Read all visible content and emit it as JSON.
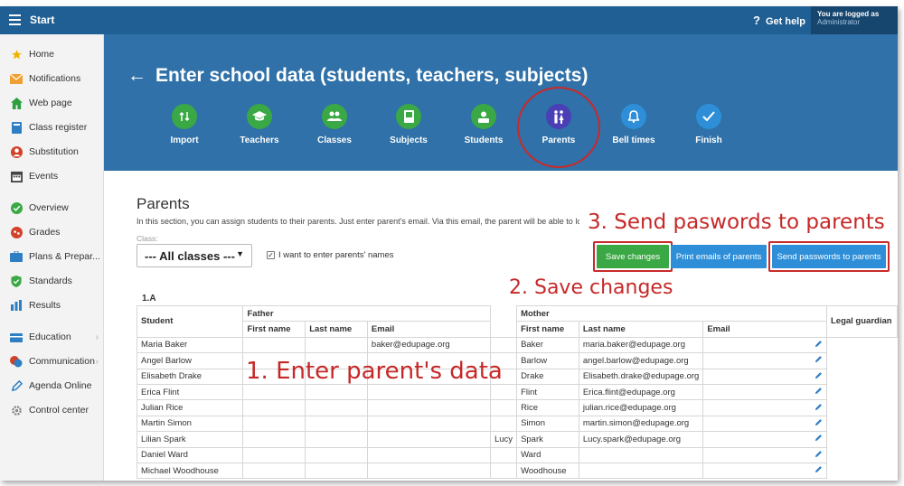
{
  "topbar": {
    "start_label": "Start",
    "help_label": "Get help",
    "help_icon": "?",
    "login_line1": "You are logged as",
    "login_line2": "Administrator"
  },
  "sidebar": {
    "items": [
      {
        "label": "Home",
        "icon": "star-icon",
        "color": "#f0b400"
      },
      {
        "label": "Notifications",
        "icon": "envelope-icon",
        "color": "#f0a030"
      },
      {
        "label": "Web page",
        "icon": "house-icon",
        "color": "#2e9e3e"
      },
      {
        "label": "Class register",
        "icon": "book-icon",
        "color": "#2e7ec4"
      },
      {
        "label": "Substitution",
        "icon": "person-icon",
        "color": "#d2412a"
      },
      {
        "label": "Events",
        "icon": "calendar-icon",
        "color": "#444444"
      },
      {
        "label": "Overview",
        "icon": "check-circle-icon",
        "color": "#3aa844"
      },
      {
        "label": "Grades",
        "icon": "grades-icon",
        "color": "#d2412a"
      },
      {
        "label": "Plans & Prepar...",
        "icon": "briefcase-icon",
        "color": "#2e7ec4"
      },
      {
        "label": "Standards",
        "icon": "shield-icon",
        "color": "#3aa844"
      },
      {
        "label": "Results",
        "icon": "bar-chart-icon",
        "color": "#2e7ec4"
      },
      {
        "label": "Education",
        "icon": "education-icon",
        "color": "#2e7ec4"
      },
      {
        "label": "Communication",
        "icon": "chat-icon",
        "color": "#d2412a"
      },
      {
        "label": "Agenda Online",
        "icon": "pen-icon",
        "color": "#2e7ec4"
      },
      {
        "label": "Control center",
        "icon": "gear-icon",
        "color": "#888888"
      }
    ]
  },
  "header": {
    "back_icon": "←",
    "title": "Enter school data (students, teachers, subjects)",
    "steps": [
      {
        "label": "Import",
        "icon": "↑↓",
        "color": "#3aa844"
      },
      {
        "label": "Teachers",
        "icon": "🎓",
        "color": "#3aa844"
      },
      {
        "label": "Classes",
        "icon": "👥",
        "color": "#3aa844"
      },
      {
        "label": "Subjects",
        "icon": "▮",
        "color": "#3aa844"
      },
      {
        "label": "Students",
        "icon": "●",
        "color": "#3aa844"
      },
      {
        "label": "Parents",
        "icon": "👫",
        "color": "#4a3fb5"
      },
      {
        "label": "Bell times",
        "icon": "🔔",
        "color": "#2e8fd8"
      },
      {
        "label": "Finish",
        "icon": "✓",
        "color": "#2e8fd8"
      }
    ]
  },
  "content": {
    "section_title": "Parents",
    "description": "In this section, you can assign students to their parents. Just enter parent's email. Via this email, the parent will be able to lo",
    "class_label": "Class:",
    "class_value": "--- All classes ---",
    "checkbox_label": "I want to enter parents' names",
    "save_button": "Save changes",
    "print_button": "Print emails of parents",
    "send_button": "Send passwords to parents",
    "table_title": "1.A"
  },
  "annotations": {
    "a1": "1. Enter parent's data",
    "a2": "2. Save changes",
    "a3": "3. Send paswords to parents"
  },
  "table": {
    "col_student": "Student",
    "col_father": "Father",
    "col_mother": "Mother",
    "col_guardian": "Legal guardian",
    "col_first": "First name",
    "col_last": "Last name",
    "col_email": "Email",
    "rows": [
      {
        "student": "Maria Baker",
        "f_first": "",
        "f_last": "",
        "f_email": "baker@edupage.org",
        "m_first": "",
        "m_last": "Baker",
        "m_email": "maria.baker@edupage.org"
      },
      {
        "student": "Angel Barlow",
        "f_first": "",
        "f_last": "",
        "f_email": "",
        "m_first": "",
        "m_last": "Barlow",
        "m_email": "angel.barlow@edupage.org"
      },
      {
        "student": "Elisabeth Drake",
        "f_first": "",
        "f_last": "",
        "f_email": "",
        "m_first": "",
        "m_last": "Drake",
        "m_email": "Elisabeth.drake@edupage.org"
      },
      {
        "student": "Erica Flint",
        "f_first": "",
        "f_last": "",
        "f_email": "",
        "m_first": "",
        "m_last": "Flint",
        "m_email": "Erica.flint@edupage.org"
      },
      {
        "student": "Julian Rice",
        "f_first": "",
        "f_last": "",
        "f_email": "",
        "m_first": "",
        "m_last": "Rice",
        "m_email": "julian.rice@edupage.org"
      },
      {
        "student": "Martin Simon",
        "f_first": "",
        "f_last": "",
        "f_email": "",
        "m_first": "",
        "m_last": "Simon",
        "m_email": "martin.simon@edupage.org"
      },
      {
        "student": "Lilian Spark",
        "f_first": "",
        "f_last": "",
        "f_email": "",
        "m_first": "Lucy",
        "m_last": "Spark",
        "m_email": "Lucy.spark@edupage.org"
      },
      {
        "student": "Daniel Ward",
        "f_first": "",
        "f_last": "",
        "f_email": "",
        "m_first": "",
        "m_last": "Ward",
        "m_email": ""
      },
      {
        "student": "Michael Woodhouse",
        "f_first": "",
        "f_last": "",
        "f_email": "",
        "m_first": "",
        "m_last": "Woodhouse",
        "m_email": ""
      }
    ]
  }
}
